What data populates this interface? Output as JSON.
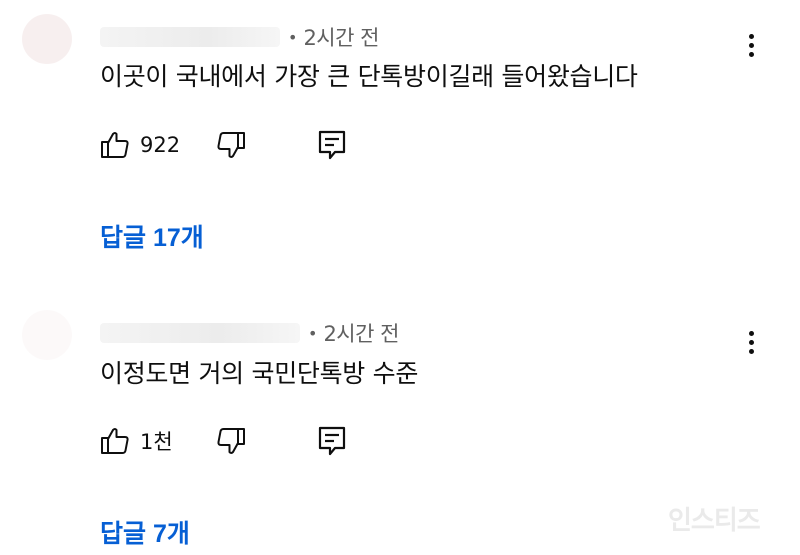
{
  "comments": [
    {
      "author": "",
      "time": "2시간 전",
      "separator": "•",
      "text": "이곳이 국내에서 가장 큰 단톡방이길래 들어왔습니다",
      "like_count": "922",
      "replies_label": "답글 17개",
      "icons": {
        "like": "thumbs-up-icon",
        "dislike": "thumbs-down-icon",
        "reply": "reply-icon",
        "more": "more-vertical-icon"
      }
    },
    {
      "author": "",
      "time": "2시간 전",
      "separator": "•",
      "text": "이정도면 거의 국민단톡방 수준",
      "like_count": "1천",
      "replies_label": "답글 7개",
      "icons": {
        "like": "thumbs-up-icon",
        "dislike": "thumbs-down-icon",
        "reply": "reply-icon",
        "more": "more-vertical-icon"
      }
    }
  ],
  "watermark": "인스티즈",
  "colors": {
    "reply_link": "#065fd4",
    "meta_text": "#606060",
    "body_text": "#0f0f0f"
  }
}
